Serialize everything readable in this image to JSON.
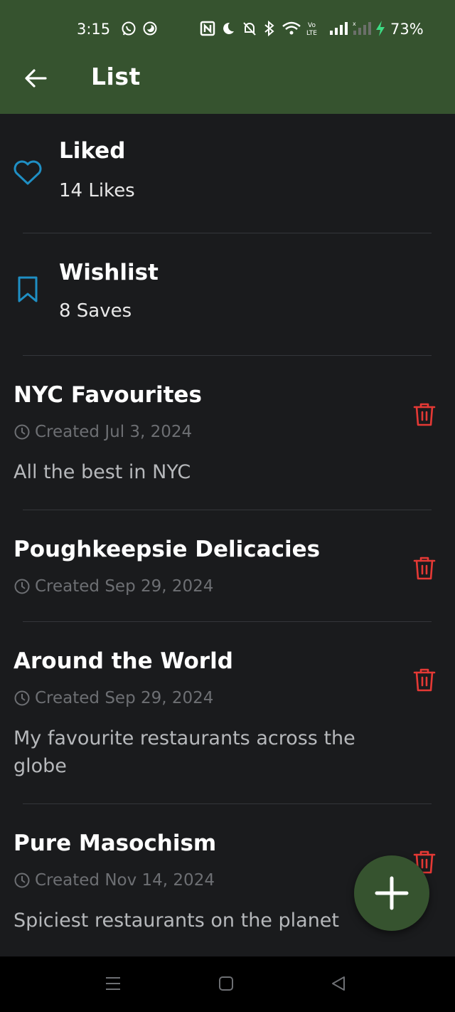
{
  "status_bar": {
    "time": "3:15",
    "battery": "73%",
    "icons": [
      "whatsapp-icon",
      "moon-app-icon",
      "nfc-icon",
      "do-not-disturb-icon",
      "mute-icon",
      "bluetooth-icon",
      "wifi-icon",
      "volte-icon",
      "signal-icon",
      "signal-no-service-icon",
      "charging-icon"
    ]
  },
  "appbar": {
    "title": "List",
    "back_icon": "arrow-left-icon"
  },
  "system_lists": [
    {
      "name": "liked",
      "title": "Liked",
      "subtitle": "14 Likes",
      "icon": "heart-icon"
    },
    {
      "name": "wishlist",
      "title": "Wishlist",
      "subtitle": "8 Saves",
      "icon": "bookmark-icon"
    }
  ],
  "lists": [
    {
      "title": "NYC Favourites",
      "created": "Created Jul 3, 2024",
      "description": "All the best in NYC"
    },
    {
      "title": "Poughkeepsie Delicacies",
      "created": "Created Sep 29, 2024",
      "description": ""
    },
    {
      "title": "Around the World",
      "created": "Created Sep 29, 2024",
      "description": "My favourite restaurants across the globe"
    },
    {
      "title": "Pure Masochism",
      "created": "Created Nov 14, 2024",
      "description": "Spiciest restaurants on the planet"
    }
  ],
  "fab": {
    "icon": "plus-icon"
  },
  "nav_bar": {
    "icons": [
      "menu-icon",
      "home-icon",
      "back-icon"
    ]
  },
  "colors": {
    "header_bg": "#36532f",
    "background": "#1a1b1d",
    "accent_blue": "#1f8fc4",
    "delete_red": "#e53935"
  }
}
